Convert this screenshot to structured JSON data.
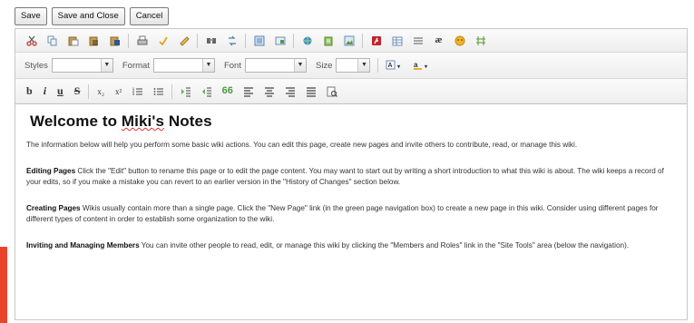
{
  "actions": {
    "save_label": "Save",
    "save_close_label": "Save and Close",
    "cancel_label": "Cancel"
  },
  "toolbar_row1": {
    "icons": [
      "cut-icon",
      "copy-icon",
      "paste-icon",
      "paste-text-icon",
      "paste-word-icon",
      "print-icon",
      "spellcheck-icon",
      "scayt-icon",
      "find-icon",
      "replace-icon",
      "select-all-icon",
      "remove-format-icon",
      "link-icon",
      "anchor-icon",
      "image-icon",
      "flash-icon",
      "table-icon",
      "horizontal-rule-icon",
      "smiley-icon",
      "special-char-icon"
    ]
  },
  "toolbar_row2": {
    "styles_label": "Styles",
    "format_label": "Format",
    "font_label": "Font",
    "size_label": "Size"
  },
  "content": {
    "title_prefix": "Welcome to ",
    "title_name": "Miki's",
    "title_suffix": " Notes",
    "intro": "The information below will help you perform some basic wiki actions. You can edit this page, create new pages and invite others to contribute, read, or manage this wiki.",
    "editing_heading": "Editing Pages",
    "editing_text": " Click the \"Edit\" button to rename this page or to edit the page content. You may want to start out by writing a short introduction to what this wiki is about. The wiki keeps a record of your edits, so if you make a mistake you can revert to an earlier version in the \"History of Changes\" section below.",
    "creating_heading": "Creating Pages",
    "creating_text": " Wikis usually contain more than a single page. Click the \"New Page\" link (in the green page navigation box) to create a new page in this wiki. Consider using different pages for different types of content in order to establish some organization to the wiki.",
    "members_heading": "Inviting and Managing Members",
    "members_text": " You can invite other people to read, edit, or manage this wiki by clicking the \"Members and Roles\" link in the \"Site Tools\" area (below the navigation)."
  },
  "colors": {
    "accent_marker": "#e8452a"
  }
}
